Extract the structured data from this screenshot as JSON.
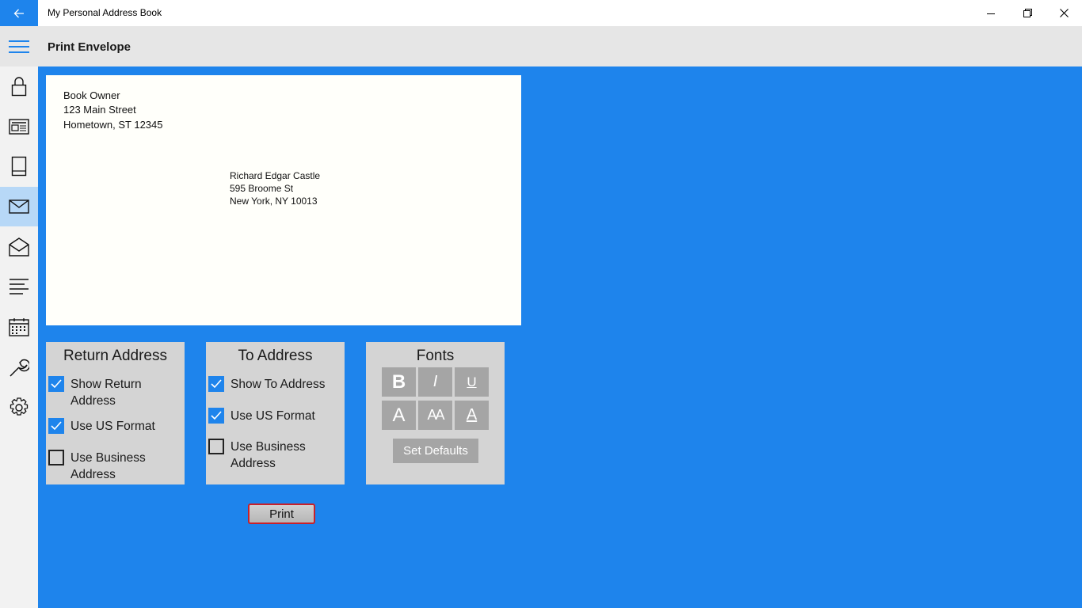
{
  "window": {
    "title": "My Personal Address Book",
    "accent": "#1e84ec"
  },
  "header": {
    "page_title": "Print Envelope"
  },
  "sidebar": {
    "items": [
      {
        "icon": "lock-icon"
      },
      {
        "icon": "newspaper-icon"
      },
      {
        "icon": "book-icon"
      },
      {
        "icon": "envelope-icon",
        "active": true
      },
      {
        "icon": "open-envelope-icon"
      },
      {
        "icon": "list-icon"
      },
      {
        "icon": "calendar-icon"
      },
      {
        "icon": "wrench-icon"
      },
      {
        "icon": "gear-icon"
      }
    ]
  },
  "envelope": {
    "return_address": [
      "Book  Owner",
      "123 Main Street",
      "Hometown, ST 12345"
    ],
    "to_address": [
      "Richard Edgar Castle",
      "595 Broome St",
      "New York, NY 10013"
    ]
  },
  "return_panel": {
    "title": "Return Address",
    "options": [
      {
        "label": "Show Return Address",
        "checked": true
      },
      {
        "label": "Use US Format",
        "checked": true
      },
      {
        "label": "Use Business Address",
        "checked": false
      }
    ]
  },
  "to_panel": {
    "title": "To Address",
    "options": [
      {
        "label": "Show To Address",
        "checked": true
      },
      {
        "label": "Use US Format",
        "checked": true
      },
      {
        "label": "Use Business Address",
        "checked": false
      }
    ]
  },
  "fonts_panel": {
    "title": "Fonts",
    "bold": "B",
    "italic": "I",
    "underline": "U",
    "larger": "A",
    "default_size": "AA",
    "smaller": "A",
    "set_defaults_label": "Set Defaults"
  },
  "print_label": "Print"
}
